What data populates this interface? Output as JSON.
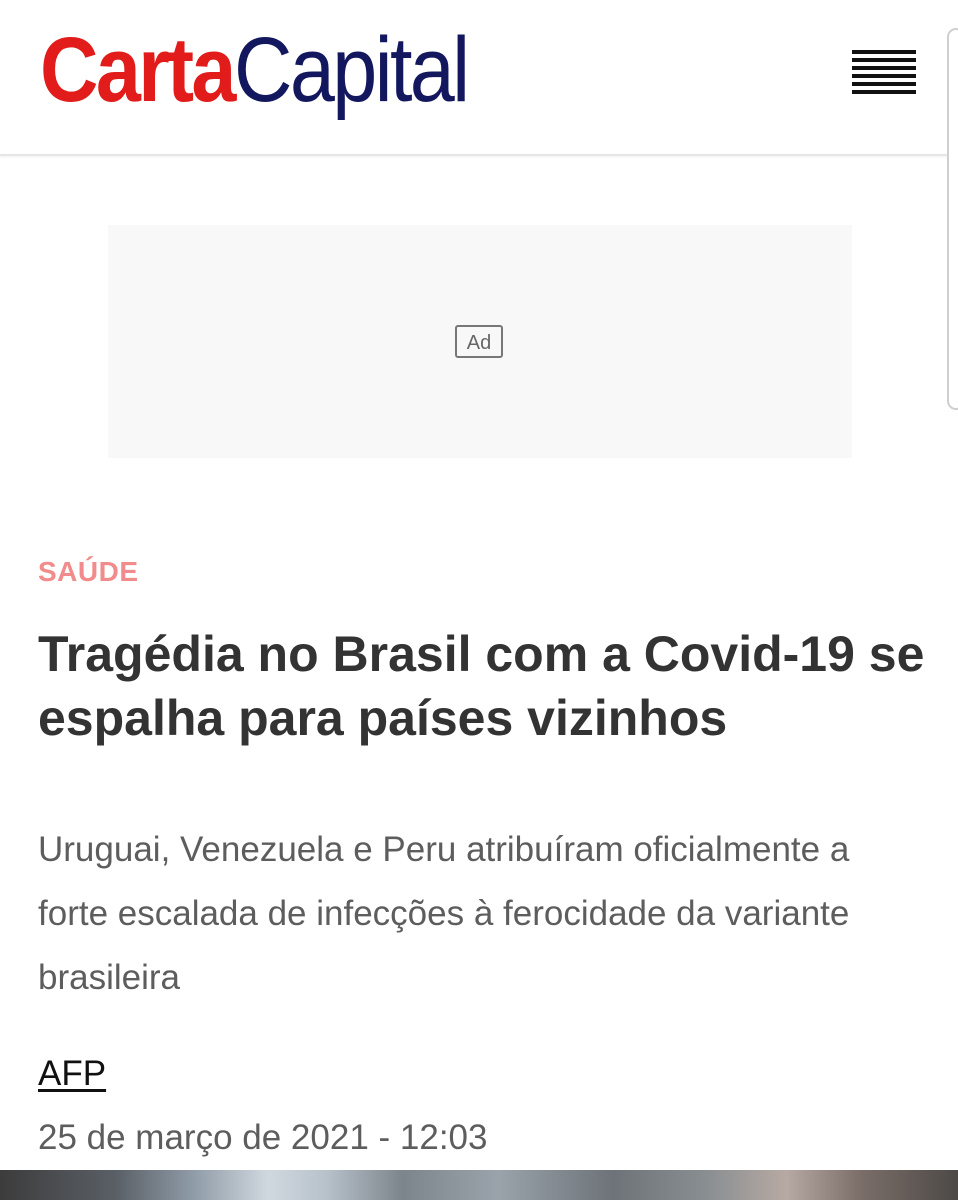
{
  "header": {
    "logo_part1": "Carta",
    "logo_part2": "Capital",
    "brand_red": "#e21b1b",
    "brand_navy": "#13175e",
    "menu_icon": "hamburger-menu-icon"
  },
  "ad": {
    "label": "Ad"
  },
  "article": {
    "category": "SAÚDE",
    "category_color": "#f28b8b",
    "title": "Tragédia no Brasil com a Covid-19 se espalha para países vizinhos",
    "subtitle": "Uruguai, Venezuela e Peru atribuíram oficialmente a forte escalada de infecções à ferocidade da variante brasileira",
    "author": "AFP",
    "date": "25 de março de 2021 - 12:03"
  }
}
